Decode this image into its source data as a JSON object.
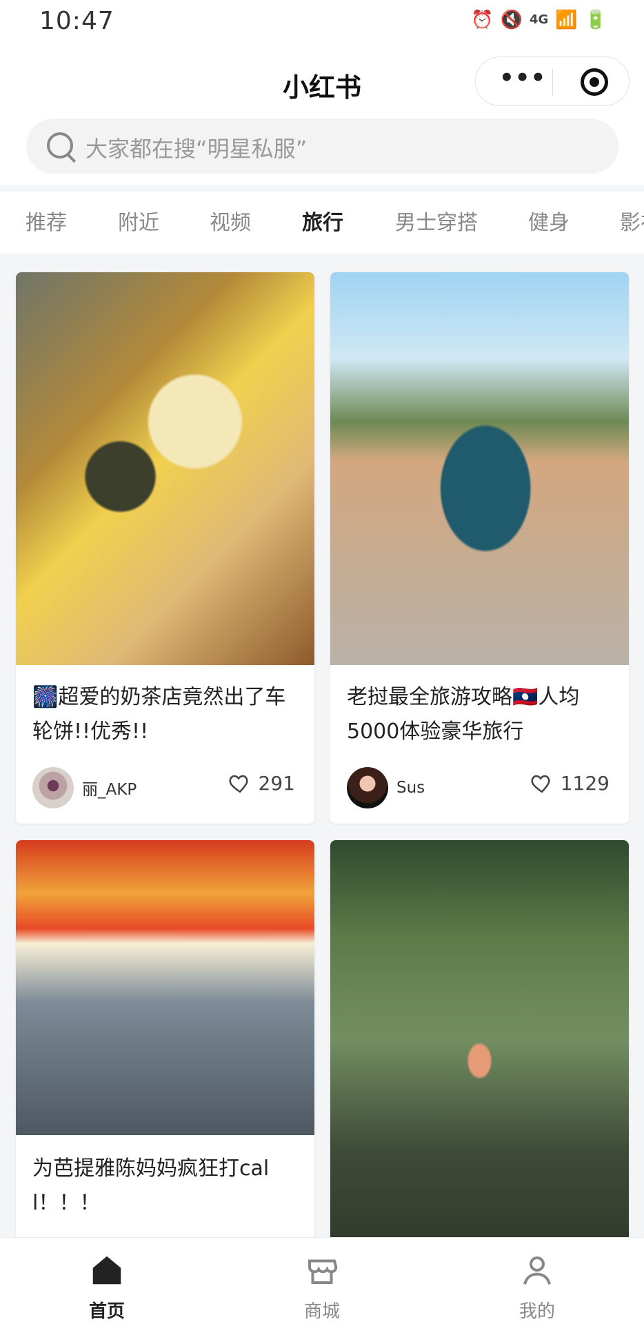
{
  "status_bar": {
    "time": "10:47",
    "network": "4G",
    "icons": [
      "alarm-icon",
      "mute-icon",
      "signal-icon",
      "battery-icon"
    ]
  },
  "title_bar": {
    "title": "小红书",
    "icons": [
      "more-icon",
      "target-icon"
    ]
  },
  "search": {
    "placeholder": "大家都在搜“明星私服”"
  },
  "tabs": [
    {
      "label": "推荐"
    },
    {
      "label": "附近"
    },
    {
      "label": "视频"
    },
    {
      "label": "旅行",
      "active": true
    },
    {
      "label": "男士穿搭"
    },
    {
      "label": "健身"
    },
    {
      "label": "影视"
    }
  ],
  "cards": [
    {
      "title": "🎆超爱的奶茶店竟然出了车轮饼!!优秀!!",
      "author": "丽_AKP",
      "likes": "291"
    },
    {
      "title": "老挝最全旅游攻略🇱🇦人均5000体验豪华旅行",
      "author": "Sus",
      "likes": "1129"
    },
    {
      "title": "为芭提雅陈妈妈疯狂打cal l！！！",
      "author": "",
      "likes": ""
    },
    {
      "title": "",
      "author": "",
      "likes": ""
    }
  ],
  "bottom_nav": [
    {
      "label": "首页",
      "active": true
    },
    {
      "label": "商城"
    },
    {
      "label": "我的"
    }
  ],
  "colors": {
    "background": "#f4f5f7",
    "active_text": "#222222",
    "inactive_text": "#888888"
  }
}
